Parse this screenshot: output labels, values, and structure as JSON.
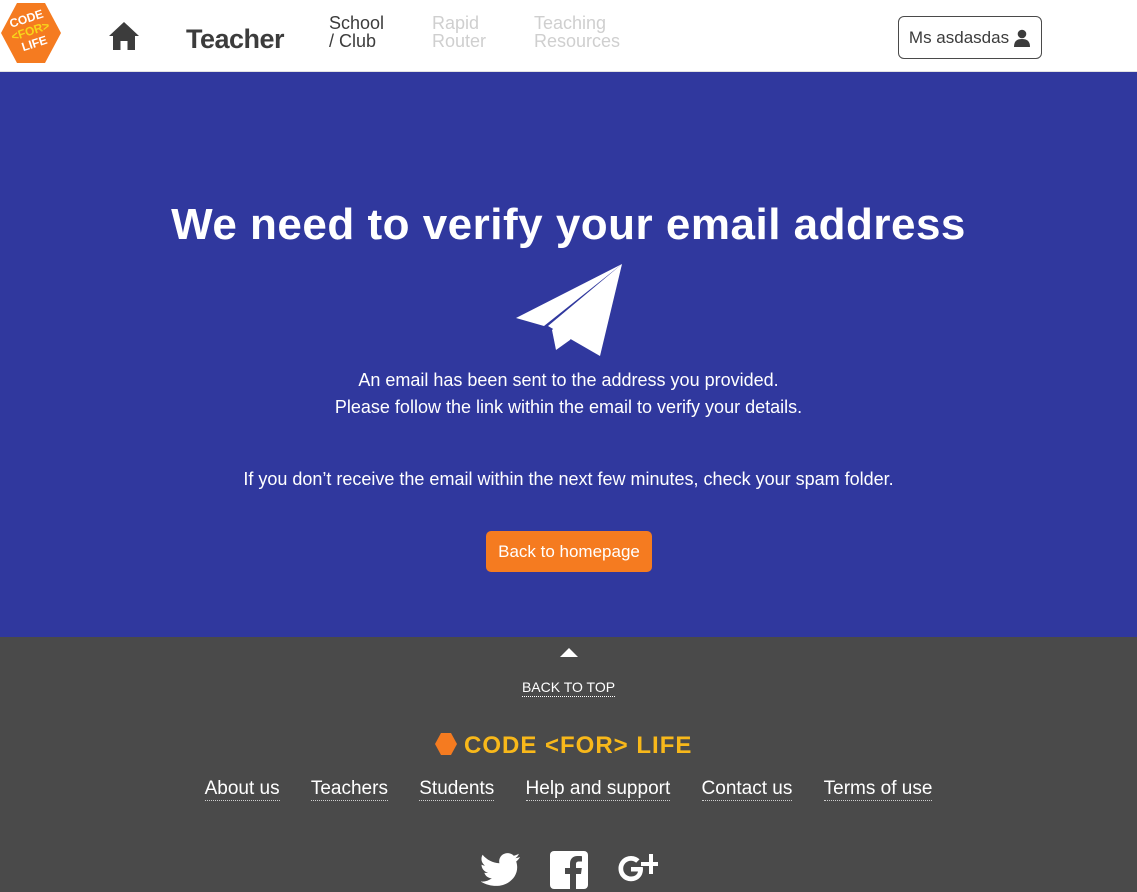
{
  "header": {
    "logo_text": [
      "CODE",
      "<FOR>",
      "LIFE"
    ],
    "home_icon": "home-icon",
    "title": "Teacher",
    "nav": [
      {
        "line1": "School",
        "line2": "/ Club",
        "state": "active"
      },
      {
        "line1": "Rapid",
        "line2": "Router",
        "state": "disabled"
      },
      {
        "line1": "Teaching",
        "line2": "Resources",
        "state": "disabled"
      }
    ],
    "user_label": "Ms asdasdas",
    "user_icon": "person-icon"
  },
  "hero": {
    "title": "We need to verify your email address",
    "icon": "paper-plane-icon",
    "line1": "An email has been sent to the address you provided.",
    "line2": "Please follow the link within the email to verify your details.",
    "line3": "If you don’t receive the email within the next few minutes, check your spam folder.",
    "button": "Back to homepage"
  },
  "footer": {
    "back_to_top": "BACK TO TOP",
    "logo_text": "CODE <FOR> LIFE",
    "links": [
      "About us",
      "Teachers",
      "Students",
      "Help and support",
      "Contact us",
      "Terms of use"
    ],
    "social": [
      "twitter-icon",
      "facebook-icon",
      "google-plus-icon"
    ]
  },
  "colors": {
    "hero_bg": "#30389e",
    "footer_bg": "#4a4a4a",
    "accent_orange": "#f57b20",
    "logo_yellow": "#f8b81a"
  }
}
